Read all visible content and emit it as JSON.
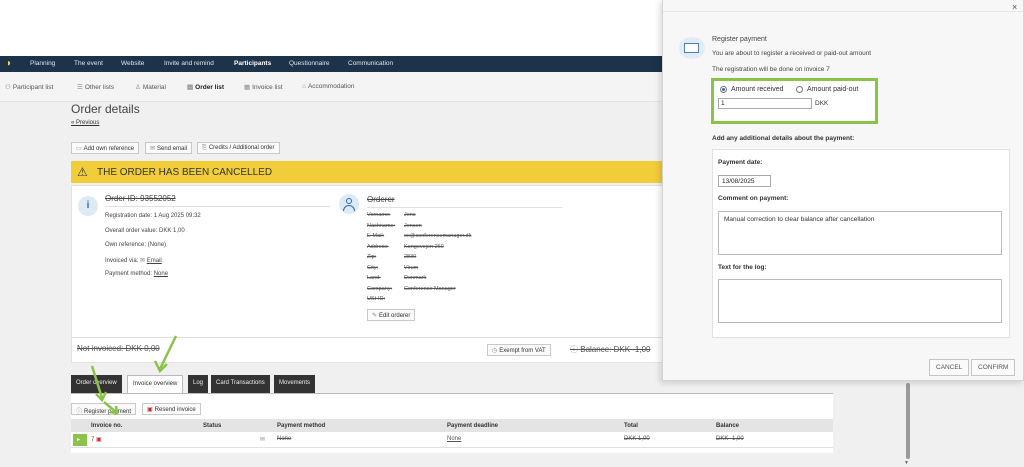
{
  "topnav": {
    "items": [
      "Planning",
      "The event",
      "Website",
      "Invite and remind",
      "Participants",
      "Questionnaire",
      "Communication"
    ],
    "active": "Participants"
  },
  "subnav": {
    "items": [
      "Participant list",
      "Other lists",
      "Material",
      "Order list",
      "Invoice list",
      "Accommodation"
    ],
    "active": "Order list"
  },
  "page": {
    "title": "Order details",
    "previous_link": "« Previous"
  },
  "toolbar": {
    "add_reference": "Add own reference",
    "send_email": "Send email",
    "credits": "Credits / Additional order"
  },
  "banner": {
    "text": "THE ORDER HAS BEEN CANCELLED"
  },
  "order": {
    "id_label": "Order ID: 93552052",
    "registration_date": "Registration date: 1 Aug 2025 09:32",
    "overall_value": "Overall order value: DKK 1,00",
    "own_reference": "Own reference: (None)",
    "invoiced_via_label": "Invoiced via:",
    "invoiced_via_value": "Email",
    "payment_method_label": "Payment method:",
    "payment_method_value": "None"
  },
  "orderer": {
    "title": "Orderer",
    "rows": [
      {
        "label": "Vorname:",
        "value": "Jens"
      },
      {
        "label": "Nachname:",
        "value": "Jensen"
      },
      {
        "label": "E-Mail:",
        "value": "ex@conferencemanager.dk"
      },
      {
        "label": "Address:",
        "value": "Kongevejen 260"
      },
      {
        "label": "Zip:",
        "value": "2830"
      },
      {
        "label": "City:",
        "value": "Virum"
      },
      {
        "label": "Land:",
        "value": "Denmark"
      },
      {
        "label": "Company:",
        "value": "Conference Manager"
      },
      {
        "label": "USt-ID:",
        "value": ""
      }
    ],
    "edit_button": "Edit orderer"
  },
  "footer": {
    "not_invoiced": "Not invoiced: DKK 0,00",
    "exempt_vat": "Exempt from VAT",
    "balance": "Balance: DKK -1,00"
  },
  "tabs": [
    "Order overview",
    "Invoice overview",
    "Log",
    "Card Transactions",
    "Movements"
  ],
  "active_tab": "Invoice overview",
  "invoice_actions": {
    "register_payment": "Register payment",
    "resend_invoice": "Resend invoice"
  },
  "invoice_table": {
    "headers": [
      "Invoice no.",
      "Status",
      "Payment method",
      "Payment deadline",
      "Total",
      "Balance"
    ],
    "rows": [
      {
        "number": "7",
        "status": "",
        "payment_method": "None",
        "payment_deadline": "None",
        "total": "DKK 1,00",
        "balance": "DKK -1,00"
      }
    ]
  },
  "modal": {
    "title": "Register payment",
    "description": "You are about to register a received or paid-out amount",
    "invoice_note": "The registration will be done on invoice 7",
    "option_received": "Amount received",
    "option_paidout": "Amount paid-out",
    "selected_option": "Amount received",
    "amount_value": "1",
    "currency": "DKK",
    "details_heading": "Add any additional details about the payment:",
    "payment_date_label": "Payment date:",
    "payment_date_value": "13/08/2025",
    "comment_label": "Comment on payment:",
    "comment_value": "Manual correction to clear balance after cancellation",
    "log_label": "Text for the log:",
    "log_value": "",
    "cancel_button": "CANCEL",
    "confirm_button": "CONFIRM",
    "close_glyph": "×"
  },
  "colors": {
    "topbar": "#1d3349",
    "banner": "#f2cd3a",
    "highlight_green": "#8bc34a",
    "link_blue": "#2a6db3"
  }
}
